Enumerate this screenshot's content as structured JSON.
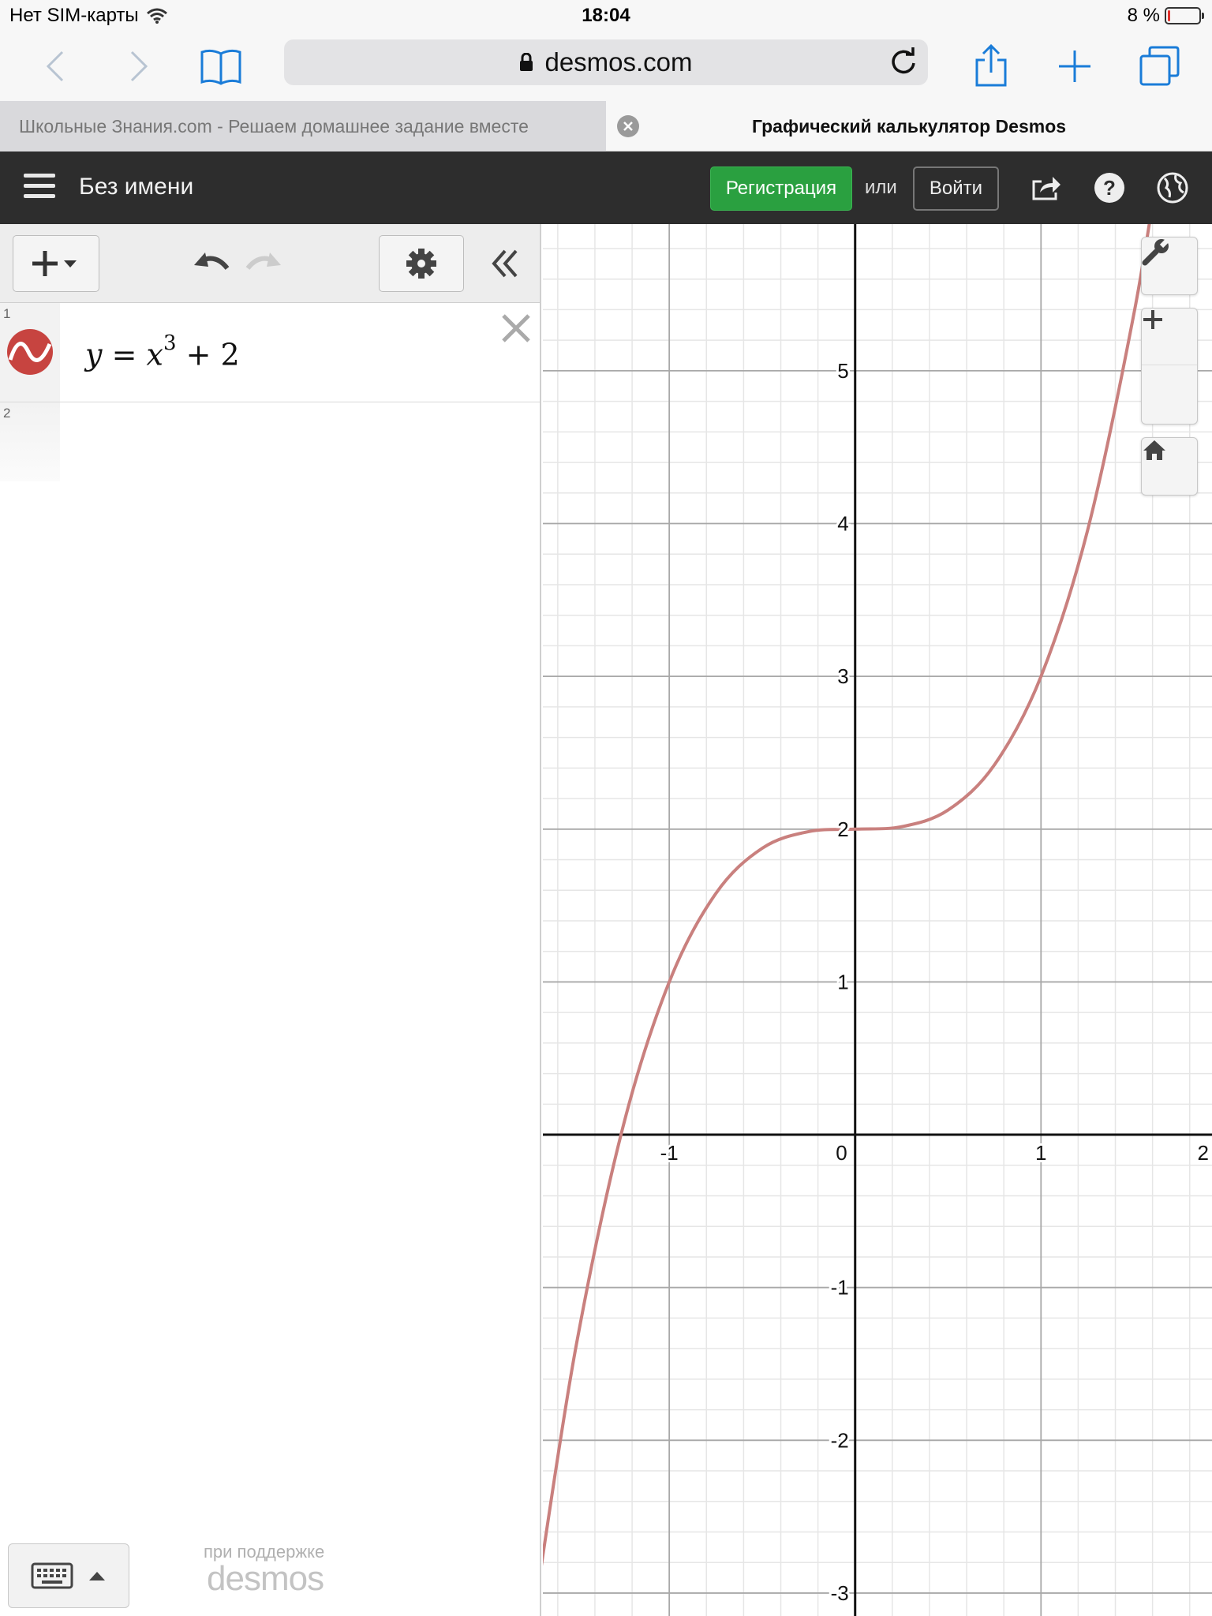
{
  "status_bar": {
    "carrier": "Нет SIM-карты",
    "time": "18:04",
    "battery": "8 %",
    "battery_level": 0.08
  },
  "browser": {
    "url": "desmos.com",
    "tabs": [
      {
        "title": "Школьные Знания.com - Решаем домашнее задание вместе",
        "active": false
      },
      {
        "title": "Графический калькулятор Desmos",
        "active": true
      }
    ],
    "icons": [
      "back-icon",
      "forward-icon",
      "bookmarks-icon",
      "lock-icon",
      "reload-icon",
      "share-icon",
      "new-tab-icon",
      "tabs-icon"
    ]
  },
  "desmos_header": {
    "title": "Без имени",
    "signup_label": "Регистрация",
    "or_label": "или",
    "login_label": "Войти",
    "icons": [
      "menu-icon",
      "share-graph-icon",
      "help-icon",
      "language-icon"
    ]
  },
  "expressions": [
    {
      "index": "1",
      "formula_y": "y",
      "formula_eq": "=",
      "formula_x": "x",
      "formula_exp": "3",
      "formula_rest": "+ 2",
      "color": "#c74440"
    },
    {
      "index": "2"
    }
  ],
  "footer": {
    "powered_by": "при поддержке",
    "logo": "desmos"
  },
  "colors": {
    "header_bg": "#2d2d2d",
    "signup_green": "#2aa040",
    "curve": "#c9807e"
  },
  "chart_data": {
    "type": "line",
    "series": [
      {
        "function": "x^3 + 2",
        "color": "#c9807e",
        "x": [
          -1.7,
          -1.5,
          -1.25,
          -1.0,
          -0.75,
          -0.5,
          -0.25,
          0.0,
          0.25,
          0.5,
          0.75,
          1.0,
          1.25,
          1.5,
          1.64
        ],
        "y": [
          -2.913,
          -1.375,
          0.047,
          1.0,
          1.578,
          1.875,
          1.984,
          2.0,
          2.016,
          2.125,
          2.422,
          3.0,
          3.953,
          5.375,
          6.411
        ]
      }
    ],
    "x_ticks": [
      "-1",
      "0",
      "1",
      "2"
    ],
    "y_ticks": [
      "-3",
      "-2",
      "-1",
      "1",
      "2",
      "3",
      "4",
      "5"
    ],
    "xlim": [
      -1.68,
      1.92
    ],
    "ylim": [
      -3.15,
      5.96
    ],
    "grid": true,
    "minor_grid": true
  }
}
